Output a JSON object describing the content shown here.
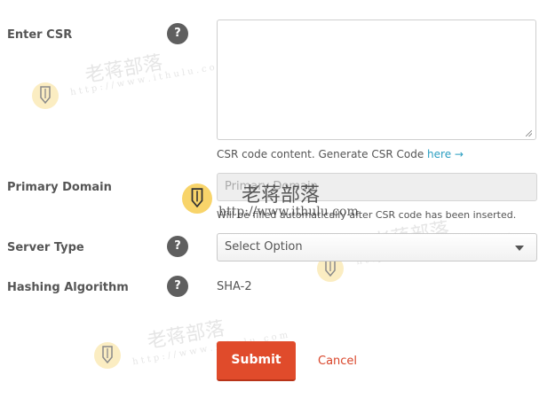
{
  "form": {
    "csr": {
      "label": "Enter CSR",
      "help": "?",
      "hint_prefix": "CSR code content. Generate CSR Code ",
      "hint_link": "here →"
    },
    "primary_domain": {
      "label": "Primary Domain",
      "placeholder": "Primary Domain",
      "hint": "Will be filled automatically after CSR code has been inserted."
    },
    "server_type": {
      "label": "Server Type",
      "help": "?",
      "selected": "Select Option"
    },
    "hashing": {
      "label": "Hashing Algorithm",
      "help": "?",
      "value": "SHA-2"
    },
    "actions": {
      "submit": "Submit",
      "cancel": "Cancel"
    }
  },
  "watermark": {
    "name": "老蒋部落",
    "url": "http://www.ithulu.com",
    "url_spaced": "h t t p : / / w w w . i t h u l u . c o m"
  }
}
